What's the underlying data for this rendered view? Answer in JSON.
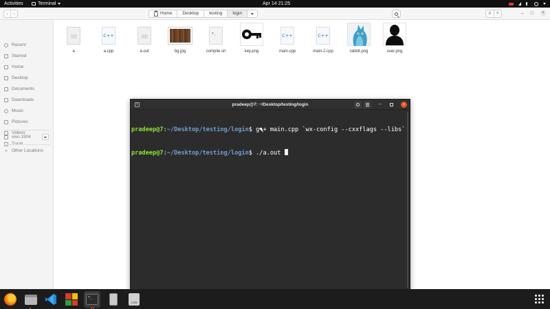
{
  "topbar": {
    "activities": "Activities",
    "app_name": "Terminal",
    "clock": "Apr 14  21:25"
  },
  "file_manager": {
    "breadcrumbs": [
      "Home",
      "Desktop",
      "testing",
      "login"
    ],
    "sidebar": {
      "places": [
        "Recent",
        "Starred",
        "Home",
        "Desktop",
        "Documents",
        "Downloads",
        "Music",
        "Pictures",
        "Videos",
        "Trash"
      ],
      "devices": [
        "vivo 1904"
      ],
      "other": "Other Locations"
    },
    "files": [
      {
        "name": "a",
        "icon": "binary-file-icon"
      },
      {
        "name": "a.cpp",
        "icon": "cpp-file-icon",
        "badge": "C++"
      },
      {
        "name": "a.out",
        "icon": "binary-file-icon"
      },
      {
        "name": "bg.jpg",
        "icon": "image-thumbnail-icon"
      },
      {
        "name": "compile.sh",
        "icon": "shell-script-icon",
        "badge": ">_"
      },
      {
        "name": "key.png",
        "icon": "key-image-icon"
      },
      {
        "name": "main.cpp",
        "icon": "cpp-file-icon",
        "badge": "C++"
      },
      {
        "name": "main-2.cpp",
        "icon": "cpp-file-icon",
        "badge": "C++"
      },
      {
        "name": "rabbit.png",
        "icon": "rabbit-image-icon"
      },
      {
        "name": "user.png",
        "icon": "user-image-icon"
      }
    ]
  },
  "terminal": {
    "title": "pradeep@7: ~/Desktop/testing/login",
    "lines": [
      {
        "user": "pradeep@7",
        "sep": ":",
        "path": "~/Desktop/testing/login",
        "prompt": "$ ",
        "command": "g++ main.cpp `wx-config --cxxflags --libs`"
      },
      {
        "user": "pradeep@7",
        "sep": ":",
        "path": "~/Desktop/testing/login",
        "prompt": "$ ",
        "command": "./a.out "
      }
    ]
  },
  "dock": {
    "items": [
      "firefox-icon",
      "files-icon",
      "vscode-icon",
      "app-grid-icon",
      "terminal-icon",
      "disk-icon",
      "usb-drive-icon",
      "show-applications-icon"
    ],
    "usb_label": "USB"
  },
  "colors": {
    "topbar": "#111111",
    "prompt_user": "#8ae234",
    "prompt_path": "#729fcf",
    "terminal_bg": "#2c2c2c",
    "close_button": "#e95420"
  }
}
